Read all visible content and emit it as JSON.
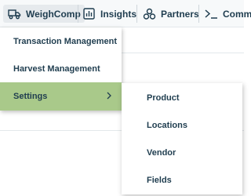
{
  "nav": {
    "weighcomp": {
      "label": "WeighComp",
      "icon": "truck-icon"
    },
    "insights": {
      "label": "Insights",
      "icon": "chart-icon"
    },
    "partners": {
      "label": "Partners",
      "icon": "partners-icon"
    },
    "commands": {
      "label": "Comm",
      "icon": "terminal-icon"
    }
  },
  "menu": {
    "items": [
      {
        "label": "Transaction Management"
      },
      {
        "label": "Harvest Management"
      },
      {
        "label": "Settings",
        "active": true
      }
    ]
  },
  "submenu": {
    "items": [
      {
        "label": "Product"
      },
      {
        "label": "Locations"
      },
      {
        "label": "Vendor"
      },
      {
        "label": "Fields"
      }
    ]
  },
  "colors": {
    "text": "#1f3d4f",
    "active_bg": "#a9c98a",
    "nav_active_bg": "#e6eaed"
  }
}
